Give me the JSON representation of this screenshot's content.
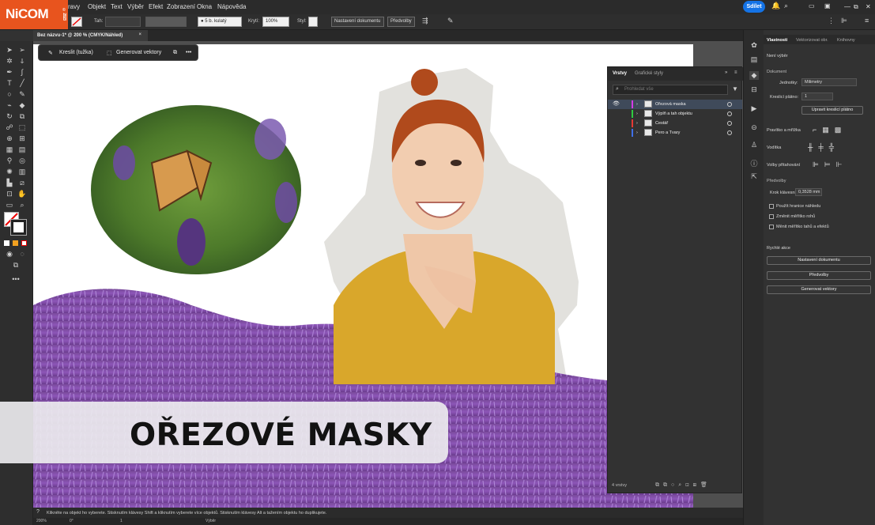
{
  "brand": {
    "logo": "NiCOM",
    "logo_small": "© 2023"
  },
  "menu": [
    "Úpravy",
    "Objekt",
    "Text",
    "Výběr",
    "Efekt",
    "Zobrazení",
    "Okna",
    "Nápověda"
  ],
  "menu_visible_first": "ravy",
  "share_label": "Sdílet",
  "control_bar": {
    "tab_label": "Tah:",
    "stroke_size": "5 b. kulatý",
    "opacity_label": "Krytí:",
    "opacity_value": "100%",
    "style_label": "Styl:",
    "doc_setup": "Nastavení dokumentu",
    "prefs": "Předvolby"
  },
  "document_tab": {
    "title": "Bez názvu-1* @ 200 % (CMYK/Náhled)",
    "close": "×"
  },
  "context_bar": {
    "draw_label": "Kreslit (tužka)",
    "vectorize_label": "Generovat vektory",
    "more": "•••"
  },
  "title_text": "OŘEZOVÉ MASKY",
  "layers_panel": {
    "tab_layers": "Vrstvy",
    "tab_styles": "Grafické styly",
    "search_placeholder": "Prohledat vše",
    "rows": [
      {
        "name": "Ořezová maska",
        "color": "#d53be8"
      },
      {
        "name": "Výplň a tah objektu",
        "color": "#2ecc40"
      },
      {
        "name": "Cestář",
        "color": "#e53935"
      },
      {
        "name": "Pero a Tvary",
        "color": "#3f6fe8"
      }
    ],
    "count": "4 vrstvy"
  },
  "properties": {
    "tab_props": "Vlastnosti",
    "tab_vector": "Vektorizovat obr.",
    "tab_lib": "Knihovny",
    "no_selection": "Není výběr",
    "document": "Dokument",
    "units_label": "Jednotky:",
    "units_value": "Milimetry",
    "artboard_label": "Kreslicí plátno:",
    "artboard_value": "1",
    "edit_artboards": "Upravit kreslicí plátno",
    "rulers": "Pravítko a mřížka",
    "guides": "Vodítka",
    "snap": "Volby přitahování",
    "prefs": "Předvolby",
    "nudge_label": "Krok klávesnice:",
    "nudge_value": "0,3528 mm",
    "opt1": "Použít hranice náhledu",
    "opt2": "Změnit měřítko rohů",
    "opt3": "Měnit měřítko tahů a efektů",
    "quick": "Rychlé akce",
    "btn_doc": "Nastavení dokumentu",
    "btn_prefs": "Předvolby",
    "btn_vec": "Generovat vektory"
  },
  "status": "Klikněte na objekt ho vyberete. Stisknutím klávesy Shift a kliknutím vyberete více objektů. Stisknutím klávesy Alt a tažením objektu ho duplikujete.",
  "bottom": {
    "zoom": "200%",
    "angle": "0°",
    "artboard": "1",
    "mode": "Výběr"
  }
}
